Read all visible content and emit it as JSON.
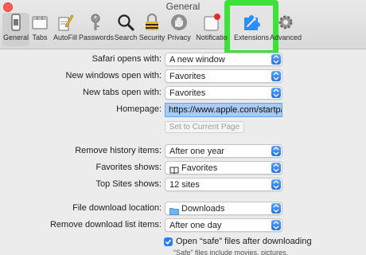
{
  "window": {
    "title": "General"
  },
  "toolbar": {
    "items": [
      {
        "label": "General"
      },
      {
        "label": "Tabs"
      },
      {
        "label": "AutoFill"
      },
      {
        "label": "Passwords"
      },
      {
        "label": "Search"
      },
      {
        "label": "Security"
      },
      {
        "label": "Privacy"
      },
      {
        "label": "Notificatio"
      },
      {
        "label": "Extensions"
      },
      {
        "label": "Advanced"
      }
    ],
    "selected": "General",
    "highlight_color": "#3ee03a"
  },
  "settings": {
    "safari_opens_with": {
      "label": "Safari opens with:",
      "value": "A new window"
    },
    "new_windows_open_with": {
      "label": "New windows open with:",
      "value": "Favorites"
    },
    "new_tabs_open_with": {
      "label": "New tabs open with:",
      "value": "Favorites"
    },
    "homepage": {
      "label": "Homepage:",
      "value": "https://www.apple.com/startpage/"
    },
    "set_current_page": {
      "label": "Set to Current Page"
    },
    "remove_history": {
      "label": "Remove history items:",
      "value": "After one year"
    },
    "favorites_shows": {
      "label": "Favorites shows:",
      "value": "Favorites"
    },
    "top_sites_shows": {
      "label": "Top Sites shows:",
      "value": "12 sites"
    },
    "file_download_location": {
      "label": "File download location:",
      "value": "Downloads"
    },
    "remove_download_list": {
      "label": "Remove download list items:",
      "value": "After one day"
    },
    "open_safe_files": {
      "label": "Open “safe” files after downloading",
      "checked": true,
      "note": "“Safe” files include movies, pictures,"
    }
  },
  "colors": {
    "accent": "#2a7ff5",
    "close": "#fc5b57"
  }
}
